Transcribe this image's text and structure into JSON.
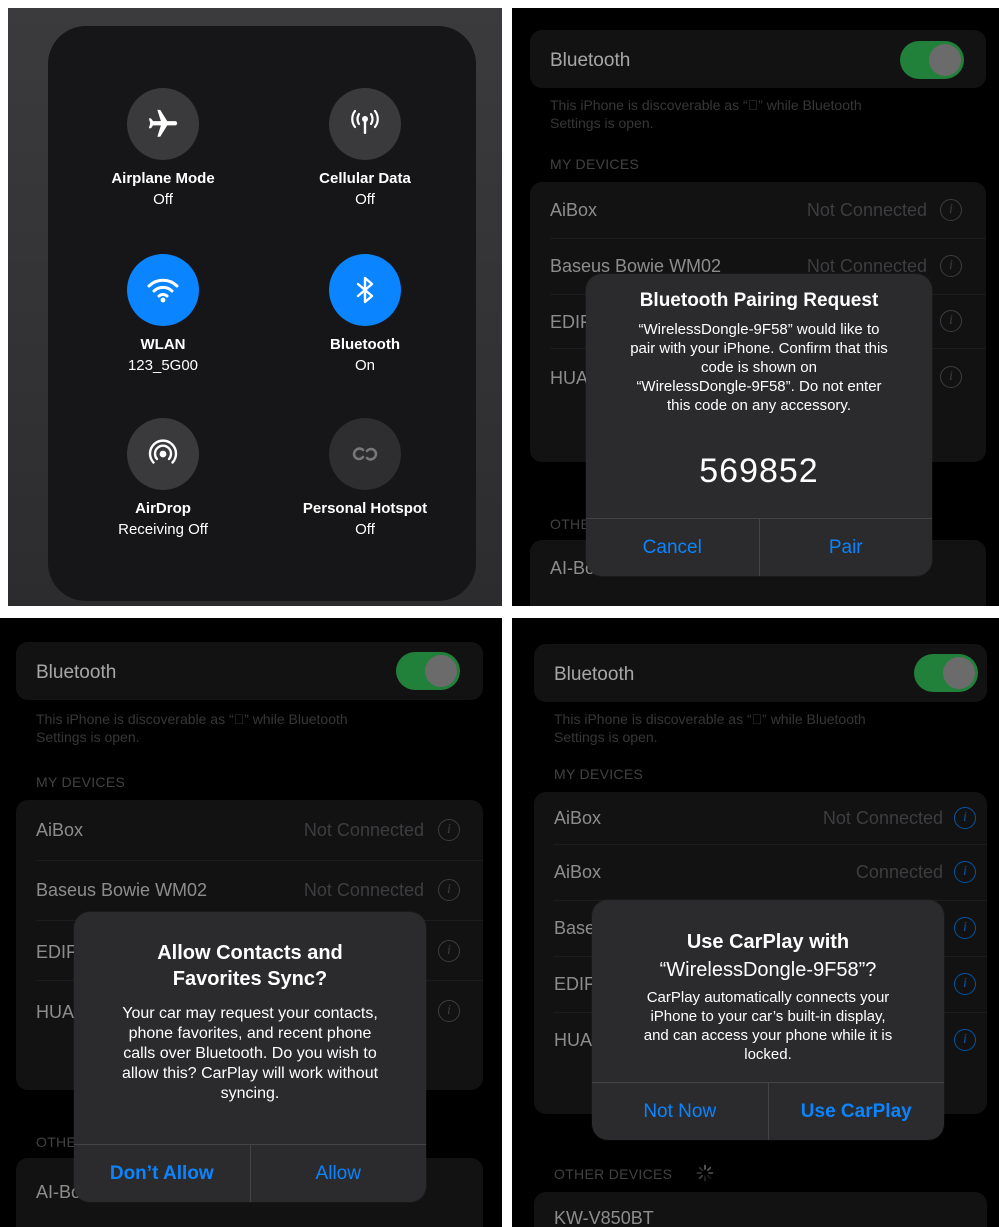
{
  "control_center": {
    "tiles": [
      {
        "title": "Airplane Mode",
        "sub": "Off",
        "icon": "airplane-icon",
        "state": "off"
      },
      {
        "title": "Cellular Data",
        "sub": "Off",
        "icon": "antenna-icon",
        "state": "off"
      },
      {
        "title": "WLAN",
        "sub": "123_5G00",
        "icon": "wifi-icon",
        "state": "on"
      },
      {
        "title": "Bluetooth",
        "sub": "On",
        "icon": "bluetooth-icon",
        "state": "on"
      },
      {
        "title": "AirDrop",
        "sub": "Receiving Off",
        "icon": "airdrop-icon",
        "state": "off"
      },
      {
        "title": "Personal Hotspot",
        "sub": "Off",
        "icon": "hotspot-icon",
        "state": "disabled"
      }
    ]
  },
  "bluetooth_settings": {
    "label": "Bluetooth",
    "toggle_on": true,
    "discoverable_line1": "This iPhone is discoverable as “” while Bluetooth",
    "discoverable_line2": "Settings is open.",
    "my_devices_header": "MY DEVICES",
    "other_devices_header": "OTHER DEVICES",
    "other_trunc": "OTHE",
    "other_trunc_short": "OTHE"
  },
  "screen2": {
    "devices": [
      {
        "name": "AiBox",
        "status": "Not Connected"
      },
      {
        "name": "Baseus Bowie WM02",
        "status": "Not Connected"
      },
      {
        "name": "EDIF",
        "status": ""
      },
      {
        "name": "HUA",
        "status": ""
      }
    ],
    "other_device": "AI-Bo",
    "alert": {
      "title": "Bluetooth Pairing Request",
      "msg": [
        "“WirelessDongle-9F58” would like to",
        "pair with your iPhone. Confirm that this",
        "code is shown on",
        "“WirelessDongle-9F58”. Do not enter",
        "this code on any accessory."
      ],
      "code": "569852",
      "cancel": "Cancel",
      "pair": "Pair"
    }
  },
  "screen3": {
    "devices": [
      {
        "name": "AiBox",
        "status": "Not Connected"
      },
      {
        "name": "Baseus Bowie WM02",
        "status": "Not Connected"
      },
      {
        "name": "EDIF",
        "status": ""
      },
      {
        "name": "HUA",
        "status": ""
      }
    ],
    "other_device": "AI-Box",
    "alert": {
      "title_line1": "Allow Contacts and",
      "title_line2": "Favorites Sync?",
      "msg": [
        "Your car may request your contacts,",
        "phone favorites, and recent phone",
        "calls over Bluetooth. Do you wish to",
        "allow this? CarPlay will work without",
        "syncing."
      ],
      "dont_allow": "Don’t Allow",
      "allow": "Allow"
    }
  },
  "screen4": {
    "devices": [
      {
        "name": "AiBox",
        "status": "Not Connected"
      },
      {
        "name": "AiBox",
        "status": "Connected"
      },
      {
        "name": "Base",
        "status": ""
      },
      {
        "name": "EDIF",
        "status": ""
      },
      {
        "name": "HUA",
        "status": ""
      }
    ],
    "other_device": "KW-V850BT",
    "alert": {
      "title_line1": "Use CarPlay with",
      "title_line2": "“WirelessDongle-9F58”?",
      "msg": [
        "CarPlay automatically connects your",
        "iPhone to your car’s built-in display,",
        "and can access your phone while it is",
        "locked."
      ],
      "not_now": "Not Now",
      "use_carplay": "Use CarPlay"
    }
  }
}
